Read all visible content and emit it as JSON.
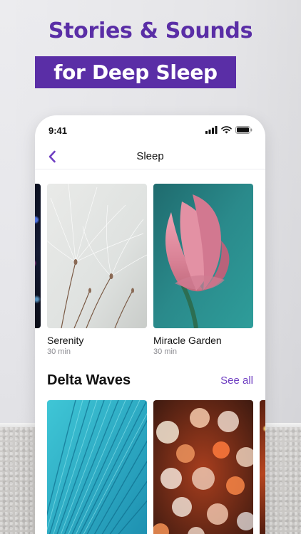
{
  "promo": {
    "headline_line1": "Stories & Sounds",
    "headline_line2": "for Deep Sleep"
  },
  "status_bar": {
    "time": "9:41",
    "icons": [
      "cellular-signal-icon",
      "wifi-icon",
      "battery-icon"
    ]
  },
  "nav": {
    "title": "Sleep",
    "back_icon": "chevron-left-icon"
  },
  "featured": [
    {
      "title": "Serenity",
      "duration": "30 min",
      "image": "dandelion-seeds"
    },
    {
      "title": "Miracle Garden",
      "duration": "30 min",
      "image": "lotus-bud"
    }
  ],
  "section": {
    "title": "Delta Waves",
    "see_all": "See all",
    "items": [
      {
        "image": "blue-palm-leaf"
      },
      {
        "image": "bokeh-lights"
      }
    ]
  },
  "colors": {
    "brand_purple": "#5a2ea6",
    "link_purple": "#6f3fc2",
    "background": "#ececef"
  }
}
